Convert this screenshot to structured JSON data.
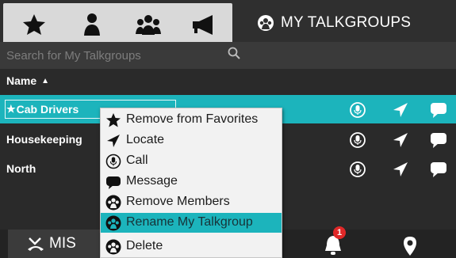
{
  "header": {
    "active_tab_title": "MY TALKGROUPS",
    "tabs": [
      "favorites-icon",
      "contacts-icon",
      "groups-icon",
      "broadcast-icon"
    ]
  },
  "search": {
    "placeholder": "Search for My Talkgroups"
  },
  "list": {
    "column_header": "Name",
    "sort": "ascending",
    "rows": [
      {
        "name": "Cab Drivers",
        "favorite": true,
        "selected": true
      },
      {
        "name": "Housekeeping",
        "favorite": false,
        "selected": false
      },
      {
        "name": "North",
        "favorite": false,
        "selected": false
      }
    ]
  },
  "context_menu": {
    "items": [
      {
        "label": "Remove from Favorites",
        "icon": "star-icon"
      },
      {
        "label": "Locate",
        "icon": "locate-arrow-icon"
      },
      {
        "label": "Call",
        "icon": "mic-icon"
      },
      {
        "label": "Message",
        "icon": "message-bubble-icon"
      },
      {
        "label": "Remove Members",
        "icon": "talkgroup-icon"
      },
      {
        "label": "Rename My Talkgroup",
        "icon": "talkgroup-icon",
        "highlighted": true
      },
      {
        "label": "Delete",
        "icon": "talkgroup-icon"
      }
    ]
  },
  "bottom_bar": {
    "tab1_label_visible": "MIS",
    "alerts_count": "1"
  },
  "colors": {
    "accent": "#1cb4bc",
    "background": "#2a2a2a",
    "menu_bg": "#f2f2f2",
    "badge": "#e02828"
  }
}
